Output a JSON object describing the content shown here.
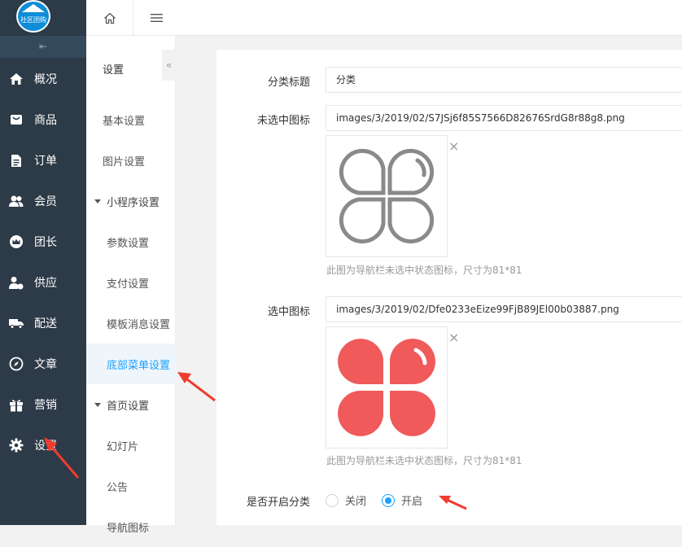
{
  "logo": {
    "text": "社区团购"
  },
  "collapse_icon": "indent-icon",
  "sidebar": {
    "items": [
      {
        "label": "概况",
        "icon": "home-icon"
      },
      {
        "label": "商品",
        "icon": "goods-icon"
      },
      {
        "label": "订单",
        "icon": "order-icon"
      },
      {
        "label": "会员",
        "icon": "members-icon"
      },
      {
        "label": "团长",
        "icon": "crown-icon"
      },
      {
        "label": "供应",
        "icon": "supplier-icon"
      },
      {
        "label": "配送",
        "icon": "truck-icon"
      },
      {
        "label": "文章",
        "icon": "compass-icon"
      },
      {
        "label": "营销",
        "icon": "gift-icon"
      },
      {
        "label": "设置",
        "icon": "gear-icon"
      }
    ]
  },
  "topbar": {
    "home_icon": "home-outline-icon",
    "menu_icon": "hamburger-icon"
  },
  "subnav": {
    "title": "设置",
    "collapse_glyph": "«",
    "items": [
      {
        "label": "基本设置"
      },
      {
        "label": "图片设置"
      },
      {
        "label": "小程序设置"
      },
      {
        "label": "参数设置"
      },
      {
        "label": "支付设置"
      },
      {
        "label": "模板消息设置"
      },
      {
        "label": "底部菜单设置"
      },
      {
        "label": "首页设置"
      },
      {
        "label": "幻灯片"
      },
      {
        "label": "公告"
      },
      {
        "label": "导航图标"
      }
    ]
  },
  "form": {
    "category_title": {
      "label": "分类标题",
      "value": "分类"
    },
    "unselected_icon": {
      "label": "未选中图标",
      "value": "images/3/2019/02/S7JSj6f85S7566D82676SrdG8r88g8.png",
      "hint": "此图为导航栏未选中状态图标，尺寸为81*81",
      "close": "×"
    },
    "selected_icon": {
      "label": "选中图标",
      "value": "images/3/2019/02/Dfe0233eEize99FjB89JEl00b03887.png",
      "hint": "此图为导航栏未选中状态图标，尺寸为81*81",
      "close": "×"
    },
    "enable_category": {
      "label": "是否开启分类",
      "options": [
        {
          "label": "关闭",
          "checked": false
        },
        {
          "label": "开启",
          "checked": true
        }
      ]
    }
  },
  "colors": {
    "sidebar_bg": "#2d3a47",
    "accent": "#1e9fff",
    "annotation_arrow": "#f03c2d",
    "icon_gray": "#8a8a8a",
    "icon_red": "#f05a5a"
  }
}
